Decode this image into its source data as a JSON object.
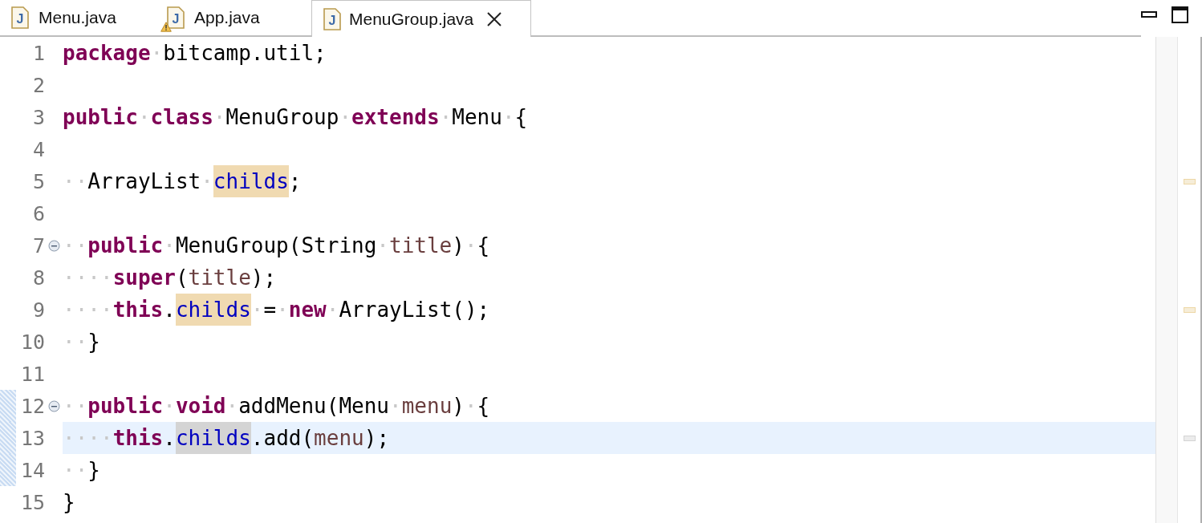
{
  "tabs": [
    {
      "label": "Menu.java",
      "icon_glyph": "J",
      "warning": false,
      "selected": false
    },
    {
      "label": "App.java",
      "icon_glyph": "J",
      "warning": true,
      "selected": false
    },
    {
      "label": "MenuGroup.java",
      "icon_glyph": "J",
      "warning": false,
      "selected": true
    }
  ],
  "lines": [
    {
      "number": "1",
      "fold": false,
      "current": false,
      "changed": false,
      "overview_mark": false,
      "tokens": [
        {
          "kind": "keyword",
          "text": "package"
        },
        {
          "kind": "ws",
          "text": "·"
        },
        {
          "kind": "plain",
          "text": "bitcamp.util;"
        }
      ]
    },
    {
      "number": "2",
      "fold": false,
      "current": false,
      "changed": false,
      "overview_mark": false
    },
    {
      "number": "3",
      "fold": false,
      "current": false,
      "changed": false,
      "overview_mark": false,
      "tokens": [
        {
          "kind": "keyword",
          "text": "public"
        },
        {
          "kind": "ws",
          "text": "·"
        },
        {
          "kind": "keyword",
          "text": "class"
        },
        {
          "kind": "ws",
          "text": "·"
        },
        {
          "kind": "plain",
          "text": "MenuGroup"
        },
        {
          "kind": "ws",
          "text": "·"
        },
        {
          "kind": "keyword",
          "text": "extends"
        },
        {
          "kind": "ws",
          "text": "·"
        },
        {
          "kind": "plain",
          "text": "Menu"
        },
        {
          "kind": "ws",
          "text": "·"
        },
        {
          "kind": "plain",
          "text": "{"
        }
      ]
    },
    {
      "number": "4",
      "fold": false,
      "current": false,
      "changed": false,
      "overview_mark": false
    },
    {
      "number": "5",
      "fold": false,
      "current": false,
      "changed": false,
      "overview_mark": true,
      "tokens": [
        {
          "kind": "ws",
          "text": "··"
        },
        {
          "kind": "plain",
          "text": "ArrayList"
        },
        {
          "kind": "ws",
          "text": "·"
        },
        {
          "kind": "field",
          "text": "childs",
          "highlighted": true,
          "write": true
        },
        {
          "kind": "plain",
          "text": ";"
        }
      ]
    },
    {
      "number": "6",
      "fold": false,
      "current": false,
      "changed": false,
      "overview_mark": false
    },
    {
      "number": "7",
      "fold": true,
      "current": false,
      "changed": false,
      "overview_mark": false,
      "tokens": [
        {
          "kind": "ws",
          "text": "··"
        },
        {
          "kind": "keyword",
          "text": "public"
        },
        {
          "kind": "ws",
          "text": "·"
        },
        {
          "kind": "plain",
          "text": "MenuGroup(String"
        },
        {
          "kind": "ws",
          "text": "·"
        },
        {
          "kind": "param",
          "text": "title"
        },
        {
          "kind": "plain",
          "text": ")"
        },
        {
          "kind": "ws",
          "text": "·"
        },
        {
          "kind": "plain",
          "text": "{"
        }
      ]
    },
    {
      "number": "8",
      "fold": false,
      "current": false,
      "changed": false,
      "overview_mark": false,
      "tokens": [
        {
          "kind": "ws",
          "text": "····"
        },
        {
          "kind": "keyword",
          "text": "super"
        },
        {
          "kind": "plain",
          "text": "("
        },
        {
          "kind": "param",
          "text": "title"
        },
        {
          "kind": "plain",
          "text": ");"
        }
      ]
    },
    {
      "number": "9",
      "fold": false,
      "current": false,
      "changed": false,
      "overview_mark": true,
      "tokens": [
        {
          "kind": "ws",
          "text": "····"
        },
        {
          "kind": "keyword",
          "text": "this"
        },
        {
          "kind": "plain",
          "text": "."
        },
        {
          "kind": "field",
          "text": "childs",
          "highlighted": true,
          "write": true
        },
        {
          "kind": "ws",
          "text": "·"
        },
        {
          "kind": "plain",
          "text": "="
        },
        {
          "kind": "ws",
          "text": "·"
        },
        {
          "kind": "keyword",
          "text": "new"
        },
        {
          "kind": "ws",
          "text": "·"
        },
        {
          "kind": "plain",
          "text": "ArrayList();"
        }
      ]
    },
    {
      "number": "10",
      "fold": false,
      "current": false,
      "changed": false,
      "overview_mark": false,
      "tokens": [
        {
          "kind": "ws",
          "text": "··"
        },
        {
          "kind": "plain",
          "text": "}"
        }
      ]
    },
    {
      "number": "11",
      "fold": false,
      "current": false,
      "changed": false,
      "overview_mark": false
    },
    {
      "number": "12",
      "fold": true,
      "current": false,
      "changed": true,
      "overview_mark": false,
      "tokens": [
        {
          "kind": "ws",
          "text": "··"
        },
        {
          "kind": "keyword",
          "text": "public"
        },
        {
          "kind": "ws",
          "text": "·"
        },
        {
          "kind": "keyword",
          "text": "void"
        },
        {
          "kind": "ws",
          "text": "·"
        },
        {
          "kind": "plain",
          "text": "addMenu(Menu"
        },
        {
          "kind": "ws",
          "text": "·"
        },
        {
          "kind": "param",
          "text": "menu"
        },
        {
          "kind": "plain",
          "text": ")"
        },
        {
          "kind": "ws",
          "text": "·"
        },
        {
          "kind": "plain",
          "text": "{"
        }
      ]
    },
    {
      "number": "13",
      "fold": false,
      "current": true,
      "changed": true,
      "overview_mark": true,
      "tokens": [
        {
          "kind": "ws",
          "text": "····"
        },
        {
          "kind": "keyword",
          "text": "this"
        },
        {
          "kind": "plain",
          "text": "."
        },
        {
          "kind": "field",
          "text": "childs",
          "highlighted": true,
          "write": false
        },
        {
          "kind": "plain",
          "text": ".add("
        },
        {
          "kind": "param",
          "text": "menu"
        },
        {
          "kind": "plain",
          "text": ");"
        }
      ]
    },
    {
      "number": "14",
      "fold": false,
      "current": false,
      "changed": true,
      "overview_mark": false,
      "tokens": [
        {
          "kind": "ws",
          "text": "··"
        },
        {
          "kind": "plain",
          "text": "}"
        }
      ]
    },
    {
      "number": "15",
      "fold": false,
      "current": false,
      "changed": false,
      "overview_mark": false,
      "tokens": [
        {
          "kind": "plain",
          "text": "}"
        }
      ]
    }
  ]
}
